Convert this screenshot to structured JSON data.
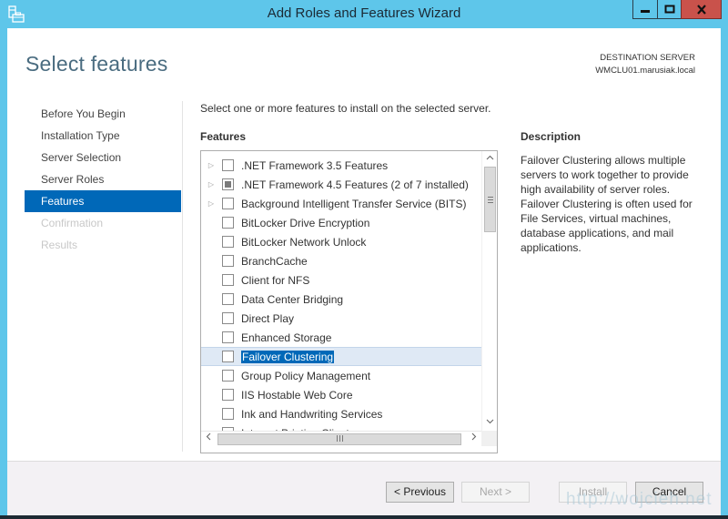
{
  "window": {
    "title": "Add Roles and Features Wizard",
    "controls": {
      "minimize": "minimize",
      "maximize": "maximize",
      "close": "close"
    }
  },
  "header": {
    "page_title": "Select features",
    "destination_label": "DESTINATION SERVER",
    "destination_server": "WMCLU01.marusiak.local"
  },
  "nav": {
    "items": [
      {
        "label": "Before You Begin",
        "state": "normal"
      },
      {
        "label": "Installation Type",
        "state": "normal"
      },
      {
        "label": "Server Selection",
        "state": "normal"
      },
      {
        "label": "Server Roles",
        "state": "normal"
      },
      {
        "label": "Features",
        "state": "active"
      },
      {
        "label": "Confirmation",
        "state": "disabled"
      },
      {
        "label": "Results",
        "state": "disabled"
      }
    ]
  },
  "main": {
    "intro": "Select one or more features to install on the selected server.",
    "features_header": "Features",
    "features": [
      {
        "label": ".NET Framework 3.5 Features",
        "expandable": true,
        "checked": "unchecked"
      },
      {
        "label": ".NET Framework 4.5 Features (2 of 7 installed)",
        "expandable": true,
        "checked": "partial"
      },
      {
        "label": "Background Intelligent Transfer Service (BITS)",
        "expandable": true,
        "checked": "unchecked"
      },
      {
        "label": "BitLocker Drive Encryption",
        "expandable": false,
        "checked": "unchecked"
      },
      {
        "label": "BitLocker Network Unlock",
        "expandable": false,
        "checked": "unchecked"
      },
      {
        "label": "BranchCache",
        "expandable": false,
        "checked": "unchecked"
      },
      {
        "label": "Client for NFS",
        "expandable": false,
        "checked": "unchecked"
      },
      {
        "label": "Data Center Bridging",
        "expandable": false,
        "checked": "unchecked"
      },
      {
        "label": "Direct Play",
        "expandable": false,
        "checked": "unchecked"
      },
      {
        "label": "Enhanced Storage",
        "expandable": false,
        "checked": "unchecked"
      },
      {
        "label": "Failover Clustering",
        "expandable": false,
        "checked": "unchecked",
        "selected": true
      },
      {
        "label": "Group Policy Management",
        "expandable": false,
        "checked": "unchecked"
      },
      {
        "label": "IIS Hostable Web Core",
        "expandable": false,
        "checked": "unchecked"
      },
      {
        "label": "Ink and Handwriting Services",
        "expandable": false,
        "checked": "unchecked"
      },
      {
        "label": "Internet Printing Client",
        "expandable": false,
        "checked": "unchecked"
      }
    ],
    "scroll_position_fraction": 0.0
  },
  "description": {
    "header": "Description",
    "text": "Failover Clustering allows multiple servers to work together to provide high availability of server roles. Failover Clustering is often used for File Services, virtual machines, database applications, and mail applications."
  },
  "footer": {
    "previous": "< Previous",
    "next": "Next >",
    "install": "Install",
    "cancel": "Cancel"
  },
  "watermark": "http://wojcieh.net",
  "colors": {
    "titlebar": "#5ec6ea",
    "accent": "#0068b8",
    "close_button": "#c9524b"
  }
}
